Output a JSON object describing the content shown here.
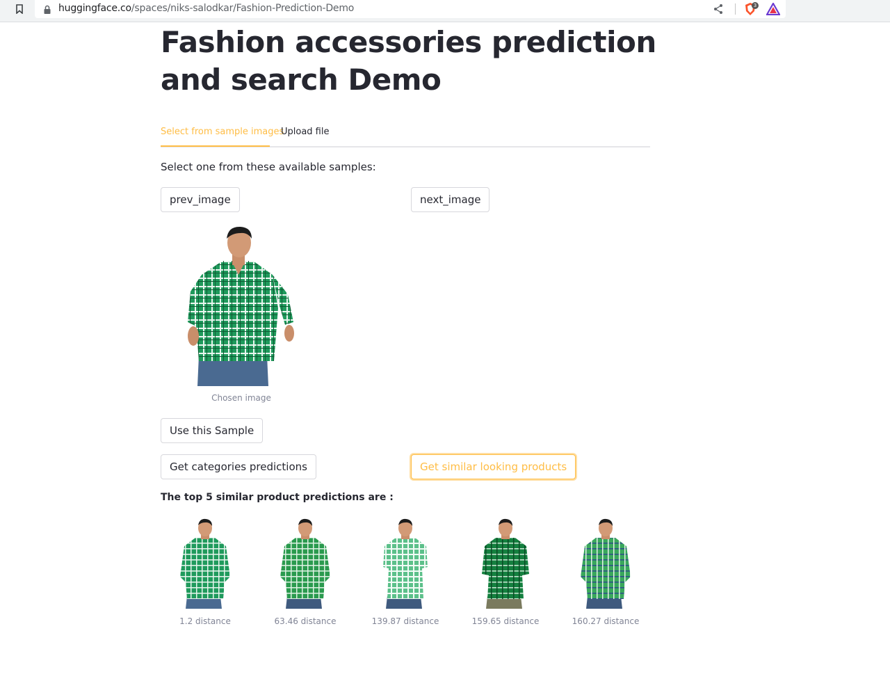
{
  "browser": {
    "url_host": "huggingface.co",
    "url_path": "/spaces/niks-salodkar/Fashion-Prediction-Demo",
    "shield_count": "3"
  },
  "page": {
    "title": "Fashion accessories prediction and search Demo"
  },
  "tabs": [
    {
      "label": "Select from sample images",
      "active": true
    },
    {
      "label": "Upload file",
      "active": false
    }
  ],
  "samples": {
    "instruction": "Select one from these available samples:",
    "prev_label": "prev_image",
    "next_label": "next_image",
    "chosen_caption": "Chosen image",
    "use_label": "Use this Sample"
  },
  "actions": {
    "categories_label": "Get categories predictions",
    "similar_label": "Get similar looking products"
  },
  "results": {
    "heading": "The top 5 similar product predictions are :",
    "items": [
      {
        "caption": "1.2 distance"
      },
      {
        "caption": "63.46 distance"
      },
      {
        "caption": "139.87 distance"
      },
      {
        "caption": "159.65 distance"
      },
      {
        "caption": "160.27 distance"
      }
    ]
  },
  "colors": {
    "accent": "#ffbd45",
    "text": "#262730",
    "caption": "#808495",
    "shirt_green": "#1f9a5c"
  }
}
